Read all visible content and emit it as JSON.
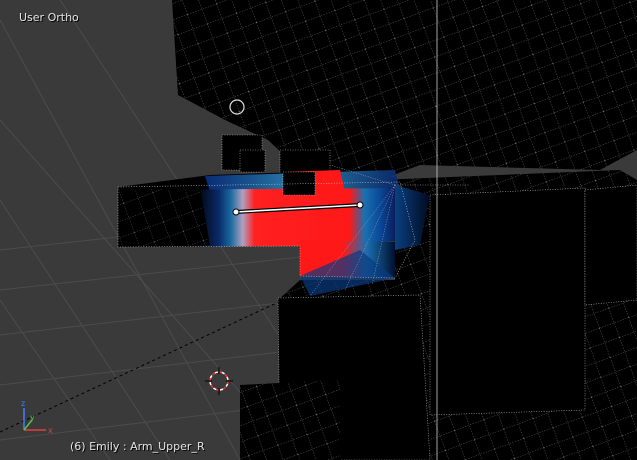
{
  "viewport": {
    "view_label": "User Ortho",
    "object_info": "(6) Emily : Arm_Upper_R",
    "background_color": "#3a3a3a",
    "grid_color": "#4a4a4a",
    "mode": "Weight Paint",
    "weight_colors": {
      "high": "#ff0000",
      "low": "#0033cc",
      "zero": "#000000"
    }
  },
  "axes_gizmo": {
    "axes": [
      "x",
      "y",
      "z"
    ],
    "colors": {
      "x": "#e04040",
      "y": "#60c040",
      "z": "#4080ff"
    }
  },
  "icons": [
    "3d-cursor-icon",
    "axes-gizmo-icon",
    "bone-icon",
    "vertex-circle-icon"
  ]
}
